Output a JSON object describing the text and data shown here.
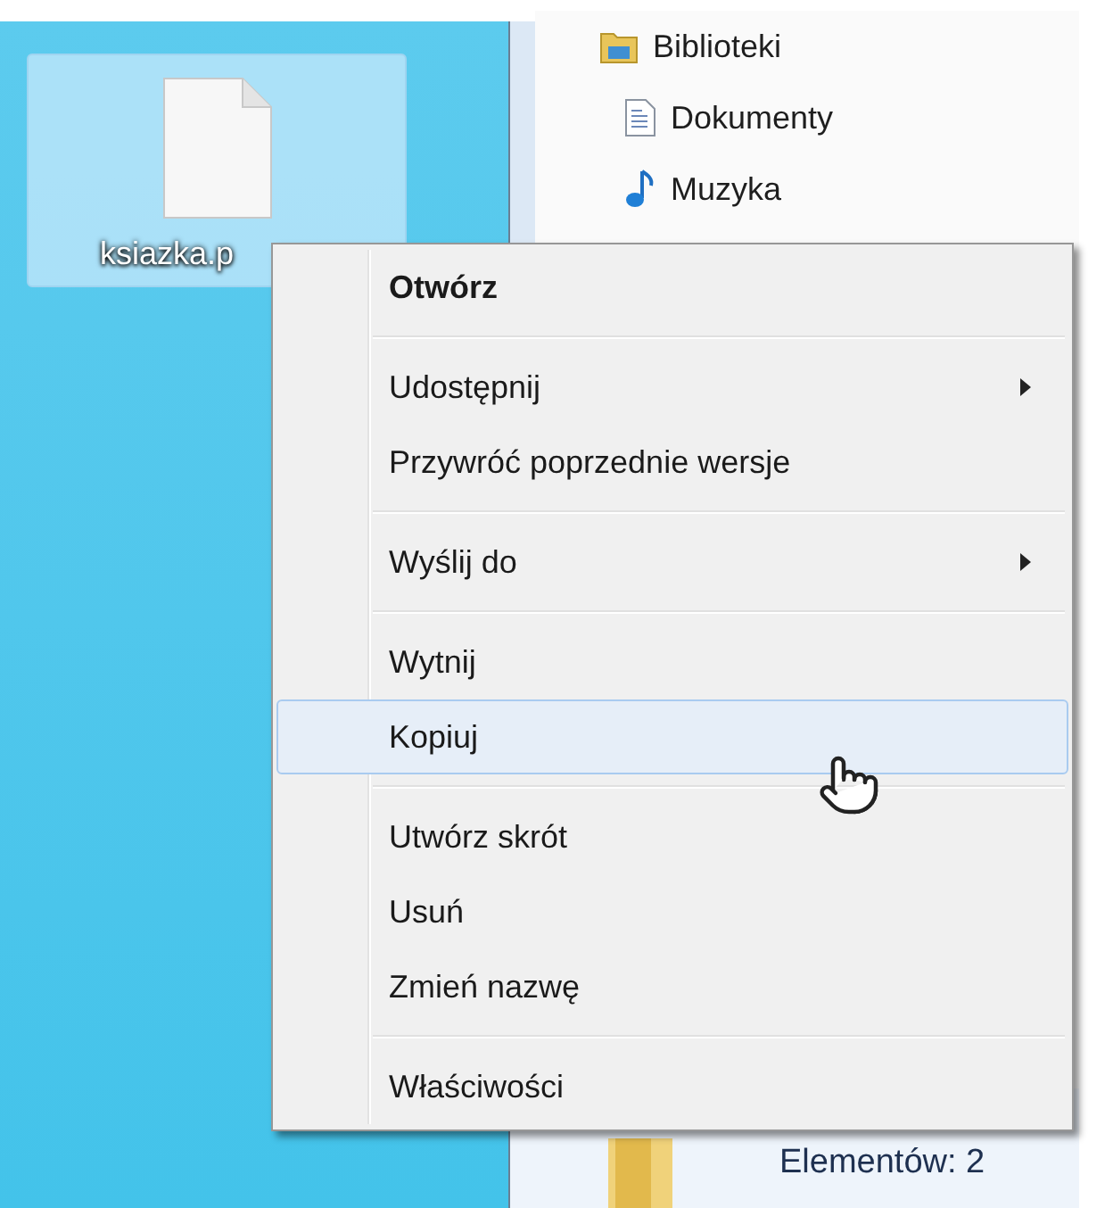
{
  "desktop_icon": {
    "label": "ksiazka.p",
    "selected": true
  },
  "navigation": {
    "items": [
      {
        "label": "Biblioteki",
        "kind": "library",
        "children": [
          {
            "label": "Dokumenty",
            "kind": "documents"
          },
          {
            "label": "Muzyka",
            "kind": "music"
          }
        ]
      }
    ]
  },
  "context_menu": {
    "items": [
      {
        "kind": "item",
        "label": "Otwórz",
        "default": true,
        "submenu": false,
        "selected": false
      },
      {
        "kind": "separator"
      },
      {
        "kind": "item",
        "label": "Udostępnij",
        "default": false,
        "submenu": true,
        "selected": false
      },
      {
        "kind": "item",
        "label": "Przywróć poprzednie wersje",
        "default": false,
        "submenu": false,
        "selected": false
      },
      {
        "kind": "separator"
      },
      {
        "kind": "item",
        "label": "Wyślij do",
        "default": false,
        "submenu": true,
        "selected": false
      },
      {
        "kind": "separator"
      },
      {
        "kind": "item",
        "label": "Wytnij",
        "default": false,
        "submenu": false,
        "selected": false
      },
      {
        "kind": "item",
        "label": "Kopiuj",
        "default": false,
        "submenu": false,
        "selected": true
      },
      {
        "kind": "separator"
      },
      {
        "kind": "item",
        "label": "Utwórz skrót",
        "default": false,
        "submenu": false,
        "selected": false
      },
      {
        "kind": "item",
        "label": "Usuń",
        "default": false,
        "submenu": false,
        "selected": false
      },
      {
        "kind": "item",
        "label": "Zmień nazwę",
        "default": false,
        "submenu": false,
        "selected": false
      },
      {
        "kind": "separator"
      },
      {
        "kind": "item",
        "label": "Właściwości",
        "default": false,
        "submenu": false,
        "selected": false
      }
    ]
  },
  "status_bar": {
    "text": "Elementów: 2"
  }
}
